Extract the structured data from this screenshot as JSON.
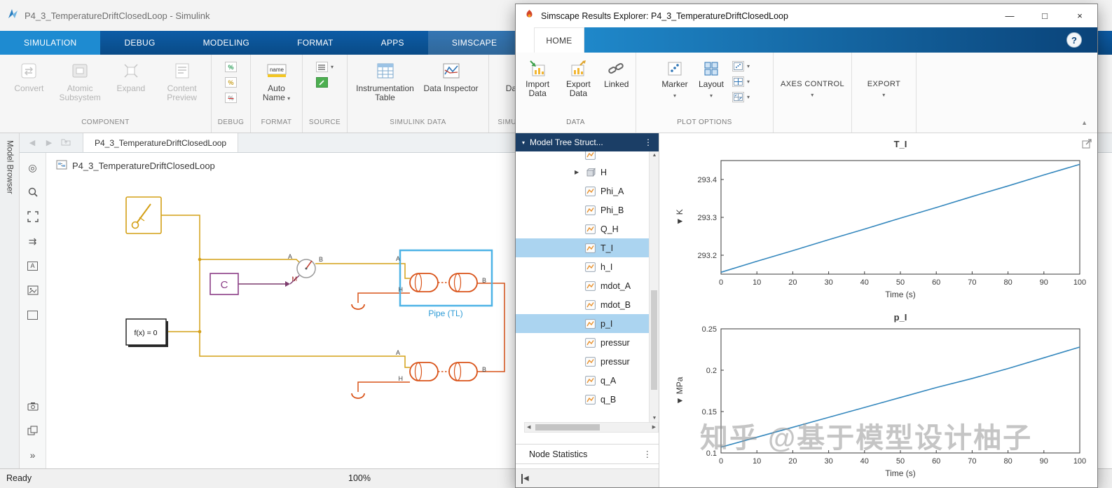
{
  "icons": {
    "minimize": "—",
    "maximize": "□",
    "close": "×",
    "help": "?",
    "menu": "⋮",
    "dropdown": "▾",
    "expander": "▶",
    "header_collapse": "▾",
    "back": "◀",
    "forward": "▶",
    "scroll_up": "▲",
    "scroll_down": "▼",
    "scroll_left": "◀",
    "scroll_right": "▶",
    "chevrons": "»",
    "units_dropdown": "▼",
    "percent": "%",
    "signal_arrows": "⇉",
    "explore": "◎",
    "skip_start": "◀"
  },
  "simulink": {
    "window_title": "P4_3_TemperatureDriftClosedLoop - Simulink",
    "ribbon_tabs": [
      "SIMULATION",
      "DEBUG",
      "MODELING",
      "FORMAT",
      "APPS",
      "SIMSCAPE"
    ],
    "ribbon": {
      "component": {
        "group_label": "COMPONENT",
        "convert": "Convert",
        "atomic_subsystem": "Atomic Subsystem",
        "expand": "Expand",
        "content_preview": "Content Preview"
      },
      "debug": {
        "group_label": "DEBUG"
      },
      "format": {
        "group_label": "FORMAT",
        "auto_name": "Auto Name",
        "auto_name_icon_text": "name"
      },
      "source": {
        "group_label": "SOURCE"
      },
      "simulink_data": {
        "group_label": "SIMULINK DATA",
        "instrumentation_table": "Instrumentation Table",
        "data_inspector": "Data Inspector"
      },
      "simulation_data": {
        "group_label": "SIMULATION DATA",
        "data_logging": "Data Logging"
      }
    },
    "breadcrumb_tab": "P4_3_TemperatureDriftClosedLoop",
    "model_browser_label": "Model Browser",
    "canvas_title": "P4_3_TemperatureDriftClosedLoop",
    "status_bar": {
      "ready": "Ready",
      "zoom": "100%"
    },
    "diagram": {
      "c_block_label": "C",
      "fx_block_label": "f(x) = 0",
      "pipe_label": "Pipe (TL)",
      "port_a": "A",
      "port_b": "B",
      "port_h": "H",
      "port_m": "M"
    }
  },
  "explorer": {
    "window_title": "Simscape Results Explorer: P4_3_TemperatureDriftClosedLoop",
    "home_tab": "HOME",
    "toolbar": {
      "import_data": "Import Data",
      "export_data": "Export Data",
      "linked": "Linked",
      "data_group": "DATA",
      "marker": "Marker",
      "layout": "Layout",
      "plot_options_group": "PLOT OPTIONS",
      "axes_control": "AXES CONTROL",
      "export": "EXPORT"
    },
    "tree_panel": {
      "header": "Model Tree Struct...",
      "items": [
        {
          "label": "H",
          "kind": "node",
          "expander": true
        },
        {
          "label": "Phi_A",
          "kind": "signal"
        },
        {
          "label": "Phi_B",
          "kind": "signal"
        },
        {
          "label": "Q_H",
          "kind": "signal"
        },
        {
          "label": "T_I",
          "kind": "signal",
          "selected": true
        },
        {
          "label": "h_I",
          "kind": "signal"
        },
        {
          "label": "mdot_A",
          "kind": "signal"
        },
        {
          "label": "mdot_B",
          "kind": "signal"
        },
        {
          "label": "p_I",
          "kind": "signal",
          "selected": true
        },
        {
          "label": "pressur",
          "kind": "signal"
        },
        {
          "label": "pressur",
          "kind": "signal"
        },
        {
          "label": "q_A",
          "kind": "signal"
        },
        {
          "label": "q_B",
          "kind": "signal"
        }
      ],
      "node_statistics_label": "Node Statistics"
    },
    "watermark": "知乎 @基于模型设计柚子"
  },
  "chart_data": [
    {
      "type": "line",
      "title": "T_I",
      "xlabel": "Time (s)",
      "ylabel": "K",
      "x": [
        0,
        10,
        20,
        30,
        40,
        50,
        60,
        70,
        80,
        90,
        100
      ],
      "y": [
        293.155,
        293.184,
        293.212,
        293.241,
        293.269,
        293.298,
        293.326,
        293.355,
        293.383,
        293.412,
        293.44
      ],
      "xlim": [
        0,
        100
      ],
      "ylim": [
        293.15,
        293.45
      ],
      "xticks": [
        0,
        10,
        20,
        30,
        40,
        50,
        60,
        70,
        80,
        90,
        100
      ],
      "yticks": [
        293.2,
        293.3,
        293.4
      ],
      "line_color": "#3487bd",
      "grid": false,
      "legend": null
    },
    {
      "type": "line",
      "title": "p_I",
      "xlabel": "Time (s)",
      "ylabel": "MPa",
      "x": [
        0,
        10,
        20,
        30,
        40,
        50,
        60,
        70,
        80,
        90,
        100
      ],
      "y": [
        0.107,
        0.119,
        0.131,
        0.143,
        0.155,
        0.167,
        0.179,
        0.19,
        0.202,
        0.215,
        0.228
      ],
      "xlim": [
        0,
        100
      ],
      "ylim": [
        0.1,
        0.25
      ],
      "xticks": [
        0,
        10,
        20,
        30,
        40,
        50,
        60,
        70,
        80,
        90,
        100
      ],
      "yticks": [
        0.1,
        0.15,
        0.2,
        0.25
      ],
      "line_color": "#3487bd",
      "grid": false,
      "legend": null
    }
  ],
  "colors": {
    "ribbon_blue": "#0d5ca6",
    "active_tab_blue": "#1e8bd1",
    "selection_blue": "#abd4f0",
    "wire_yellow": "#d4a017",
    "pipe_orange": "#d95319",
    "pipe_selection": "#4db3e6",
    "pipe_label_text": "#2e9bd6"
  }
}
